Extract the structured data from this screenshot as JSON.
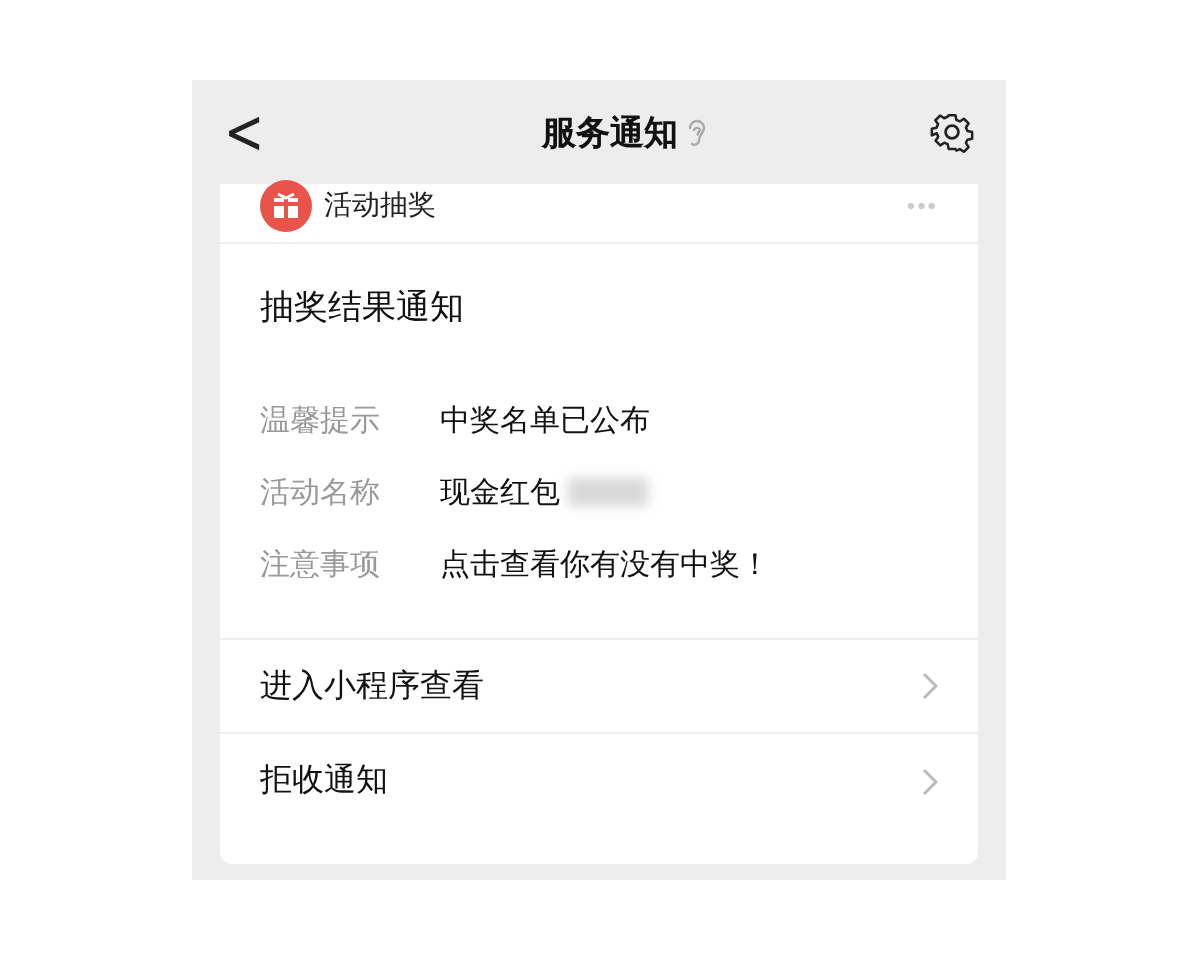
{
  "header": {
    "back": "<",
    "title": "服务通知"
  },
  "card": {
    "source": "活动抽奖",
    "more": "•••",
    "title": "抽奖结果通知",
    "fields": [
      {
        "label": "温馨提示",
        "value": "中奖名单已公布",
        "redacted": false
      },
      {
        "label": "活动名称",
        "value": "现金红包",
        "redacted": true
      },
      {
        "label": "注意事项",
        "value": "点击查看你有没有中奖！",
        "redacted": false
      }
    ],
    "actions": [
      {
        "label": "进入小程序查看"
      },
      {
        "label": "拒收通知"
      }
    ]
  }
}
